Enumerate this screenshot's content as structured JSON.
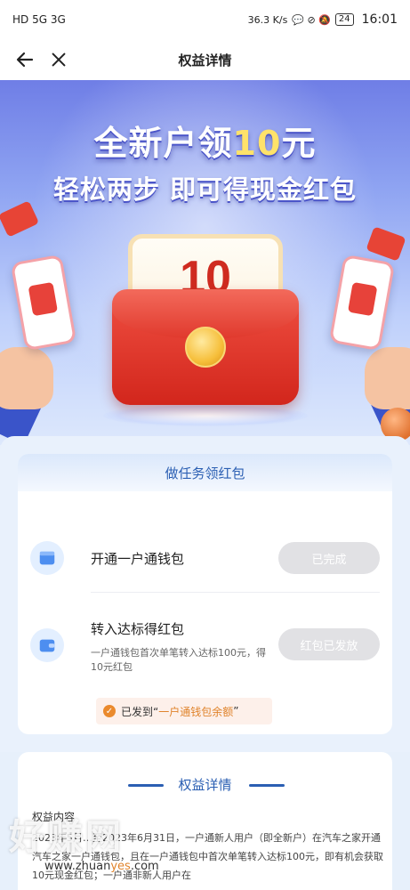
{
  "status_bar": {
    "network": "HD 5G 3G",
    "speed": "36.3 K/s",
    "battery": "24",
    "time": "16:01"
  },
  "nav": {
    "title": "权益详情",
    "back_icon": "arrow-left-icon",
    "close_icon": "close-icon"
  },
  "banner": {
    "headline_prefix": "全新户领",
    "headline_amount": "10",
    "headline_suffix": "元",
    "subheadline": "轻松两步 即可得现金红包",
    "envelope_amount": "10"
  },
  "tasks": {
    "header": "做任务领红包",
    "items": [
      {
        "name": "开通一户通钱包",
        "description": "",
        "button": "已完成",
        "icon": "wallet-box-icon"
      },
      {
        "name": "转入达标得红包",
        "description": "一户通钱包首次单笔转入达标100元，得10元红包",
        "button": "红包已发放",
        "icon": "wallet-icon"
      }
    ],
    "sent_prefix": "已发到“",
    "sent_target": "一户通钱包余额",
    "sent_suffix": "”"
  },
  "details": {
    "title": "权益详情",
    "section_label": "权益内容",
    "body": "2023年5月…至2023年6月31日，一户通新人用户（即全新户）在汽车之家开通汽车之家一户通钱包，且在一户通钱包中首次单笔转入达标100元，即有机会获取10元现金红包；一户通非新人用户在"
  },
  "watermark": {
    "text": "好赚网",
    "url_prefix": "www.zhuan",
    "url_mid": "yes",
    "url_suffix": ".com"
  },
  "colors": {
    "accent_blue": "#2b5fb3",
    "disabled_button": "#e1e1e4",
    "highlight_orange": "#e0832b",
    "envelope_red": "#d2261c"
  }
}
